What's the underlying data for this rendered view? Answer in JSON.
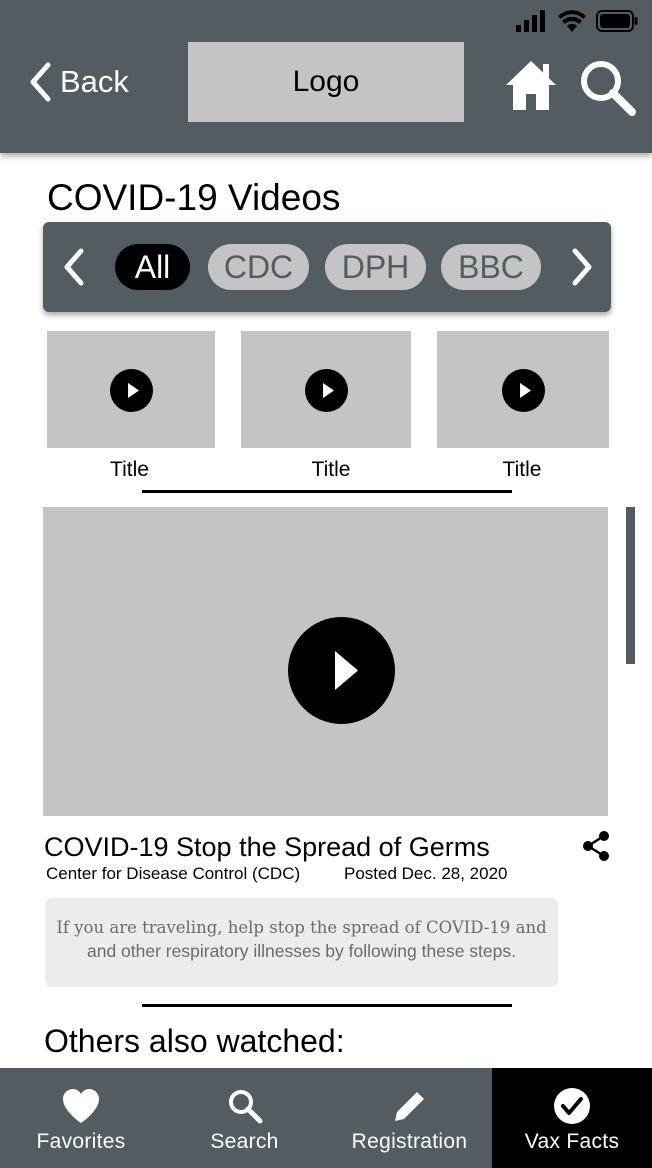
{
  "header": {
    "back_label": "Back",
    "logo_text": "Logo",
    "icons": {
      "back": "chevron-left-icon",
      "home": "home-icon",
      "search": "search-icon"
    }
  },
  "status_bar": {
    "icons": [
      "cellular-signal-icon",
      "wifi-icon",
      "battery-icon"
    ]
  },
  "page": {
    "title": "COVID-19 Videos"
  },
  "filters": {
    "chips": [
      {
        "label": "All",
        "active": true
      },
      {
        "label": "CDC",
        "active": false
      },
      {
        "label": "DPH",
        "active": false
      },
      {
        "label": "BBC",
        "active": false
      }
    ]
  },
  "thumbnails": [
    {
      "title": "Title"
    },
    {
      "title": "Title"
    },
    {
      "title": "Title"
    }
  ],
  "featured_video": {
    "title": "COVID-19 Stop the Spread of Germs",
    "source": "Center for Disease Control (CDC)",
    "posted": "Posted Dec. 28, 2020",
    "description_line1": "If you are traveling, help stop the spread of COVID-19 and",
    "description_line2": "and other respiratory illnesses by following these steps."
  },
  "others": {
    "heading": "Others also watched:"
  },
  "bottom_nav": {
    "items": [
      {
        "label": "Favorites",
        "icon": "heart-icon",
        "active": false
      },
      {
        "label": "Search",
        "icon": "search-icon",
        "active": false
      },
      {
        "label": "Registration",
        "icon": "pencil-icon",
        "active": false
      },
      {
        "label": "Vax Facts",
        "icon": "check-circle-icon",
        "active": true
      }
    ]
  },
  "colors": {
    "header": "#535c60",
    "placeholder": "#c4c4c4",
    "active": "#000000",
    "description_bg": "#ececec"
  }
}
